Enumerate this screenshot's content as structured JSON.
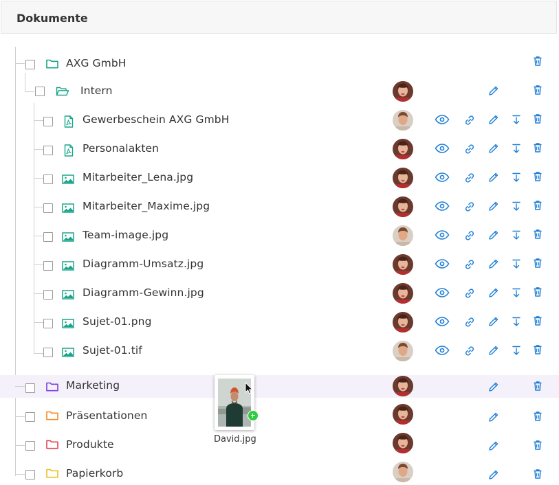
{
  "panel": {
    "title": "Dokumente"
  },
  "colors": {
    "accent": "#1f7fd6",
    "folder_green": "#1aa58a",
    "folder_purple": "#7b3fe4",
    "folder_orange": "#f58b1f",
    "folder_red": "#e0454f",
    "folder_yellow": "#e8c21b",
    "file_green": "#1aa58a",
    "row_highlight": "#f4f1fb"
  },
  "tree": {
    "root": {
      "label": "AXG GmbH",
      "icon": "folder-icon"
    },
    "intern": {
      "label": "Intern",
      "icon": "folder-open-icon"
    },
    "files": [
      {
        "label": "Gewerbeschein AXG GmbH",
        "icon": "pdf-file-icon"
      },
      {
        "label": "Personalakten",
        "icon": "pdf-file-icon"
      },
      {
        "label": "Mitarbeiter_Lena.jpg",
        "icon": "image-file-icon"
      },
      {
        "label": "Mitarbeiter_Maxime.jpg",
        "icon": "image-file-icon"
      },
      {
        "label": "Team-image.jpg",
        "icon": "image-file-icon"
      },
      {
        "label": "Diagramm-Umsatz.jpg",
        "icon": "image-file-icon"
      },
      {
        "label": "Diagramm-Gewinn.jpg",
        "icon": "image-file-icon"
      },
      {
        "label": "Sujet-01.png",
        "icon": "image-file-icon"
      },
      {
        "label": "Sujet-01.tif",
        "icon": "image-file-icon"
      }
    ],
    "folders": [
      {
        "label": "Marketing",
        "icon": "folder-icon"
      },
      {
        "label": "Präsentationen",
        "icon": "folder-icon"
      },
      {
        "label": "Produkte",
        "icon": "folder-icon"
      },
      {
        "label": "Papierkorb",
        "icon": "folder-icon"
      }
    ]
  },
  "actions": {
    "view": "eye-icon",
    "link": "link-icon",
    "edit": "pencil-icon",
    "download": "download-icon",
    "delete": "trash-icon"
  },
  "drag": {
    "filename": "David.jpg",
    "badge_icon": "plus-icon",
    "cursor_icon": "cursor-arrow-icon"
  }
}
